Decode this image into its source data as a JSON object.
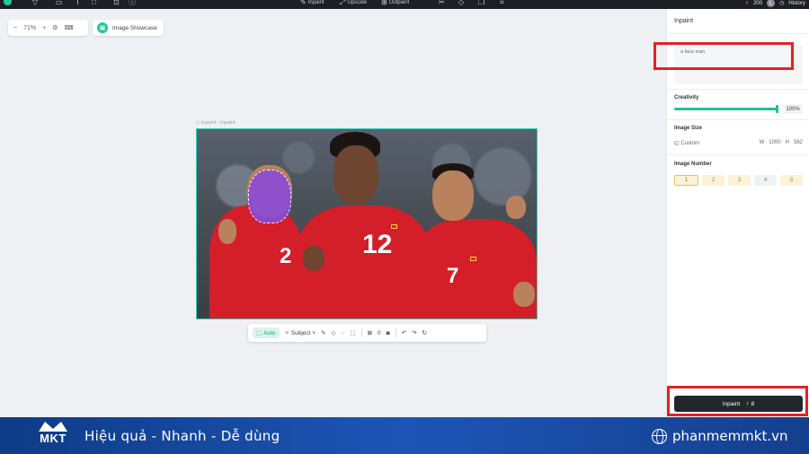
{
  "topbar": {
    "items": [
      "Inpaint",
      "Upscale",
      "Outpaint"
    ],
    "credits": "200",
    "avatar_initial": "L",
    "history_label": "History"
  },
  "canvas": {
    "zoom": "71%",
    "showcase_label": "Image Showcase",
    "frame_label": "Inpaint - Inpaint"
  },
  "toolbar": {
    "auto_label": "Auto",
    "subject_label": "Subject",
    "count": "0"
  },
  "panel": {
    "title": "Inpaint",
    "prompt_value": "a face man",
    "creativity_label": "Creativity",
    "creativity_value": "100%",
    "creativity_level": 1.0,
    "image_size_label": "Image Size",
    "size_mode": "Custom",
    "width_label": "W",
    "width_value": "1000",
    "height_label": "H",
    "height_value": "562",
    "image_number_label": "Image Number",
    "image_numbers": [
      "1",
      "2",
      "3",
      "4",
      "8"
    ],
    "selected_number": "1",
    "inpaint_button_label": "Inpaint",
    "inpaint_cost": "8"
  },
  "photo": {
    "jersey_numbers": [
      "2",
      "12",
      "7"
    ]
  },
  "banner": {
    "logo_text": "MKT",
    "slogan": "Hiệu quả - Nhanh - Dễ dùng",
    "site": "phanmemmkt.vn"
  },
  "colors": {
    "accent": "#22c09a",
    "highlight_red": "#e02323",
    "banner_blue": "#1d55b6",
    "mask_purple": "#8a4bd8"
  }
}
